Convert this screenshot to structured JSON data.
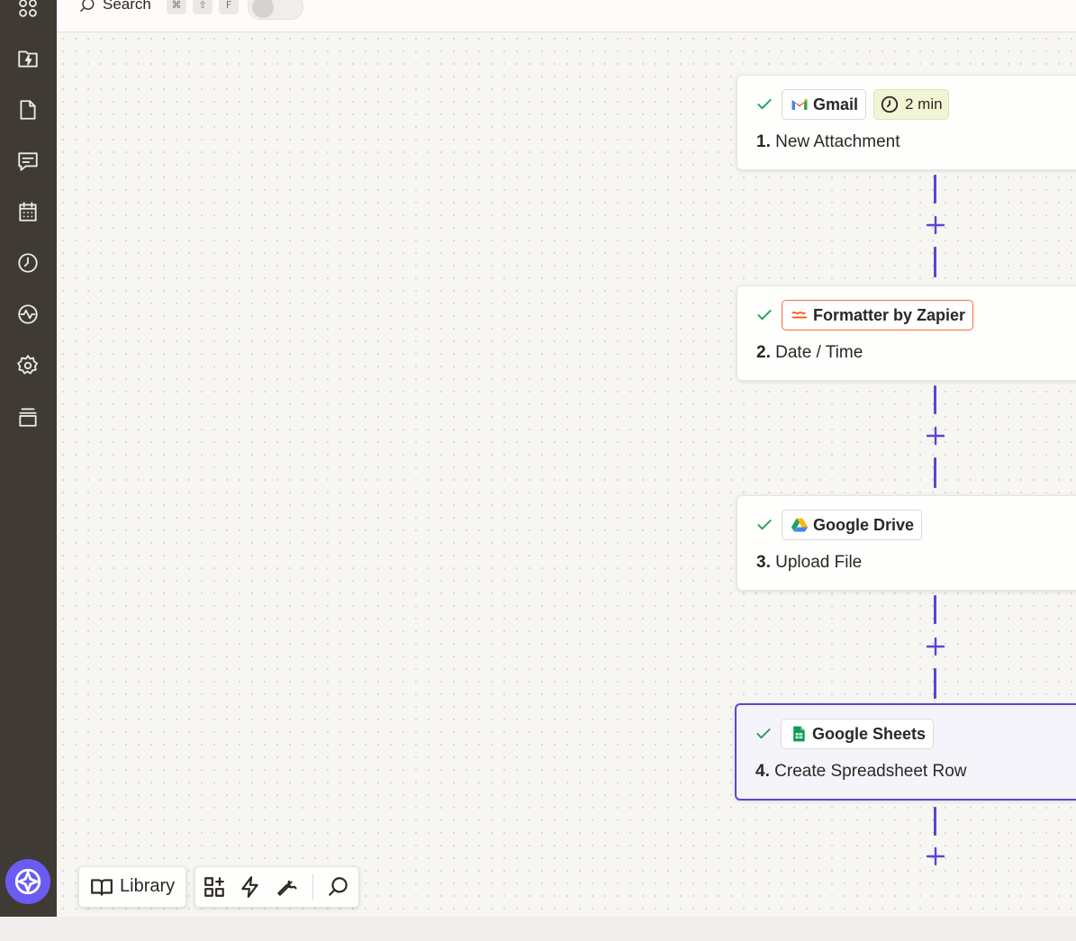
{
  "search": {
    "label": "Search",
    "shortcut": [
      "⌘",
      "⇧",
      "F"
    ]
  },
  "sidebar": {
    "icons": [
      "apps-icon",
      "zap-folder-icon",
      "file-icon",
      "chat-icon",
      "calendar-icon",
      "history-icon",
      "activity-icon",
      "settings-icon",
      "archive-icon"
    ],
    "bottom": "copilot-icon"
  },
  "steps": [
    {
      "number": "1.",
      "app": "Gmail",
      "title": "New Attachment",
      "badge": "2 min",
      "status": "complete"
    },
    {
      "number": "2.",
      "app": "Formatter by Zapier",
      "title": "Date / Time",
      "status": "complete"
    },
    {
      "number": "3.",
      "app": "Google Drive",
      "title": "Upload File",
      "status": "complete"
    },
    {
      "number": "4.",
      "app": "Google Sheets",
      "title": "Create Spreadsheet Row",
      "status": "complete",
      "selected": true
    }
  ],
  "bottom_toolbar": {
    "library_label": "Library",
    "tools": [
      "add-widget-icon",
      "zap-icon",
      "wrench-icon",
      "search-icon"
    ]
  },
  "colors": {
    "sidebar": "#403a35",
    "accent": "#5846d0",
    "copilot": "#6a5cf2",
    "success": "#1f9d55",
    "formatter": "#ff6b3d"
  }
}
